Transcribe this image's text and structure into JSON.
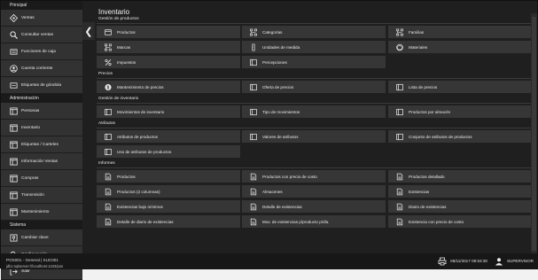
{
  "sidebar": {
    "sections": [
      {
        "title": "Principal",
        "items": [
          {
            "label": "Ventas",
            "icon": "compass-icon"
          },
          {
            "label": "Consultar ventas",
            "icon": "search-icon"
          },
          {
            "label": "Funciones de caja",
            "icon": "cash-register-icon"
          },
          {
            "label": "Cuenta corriente",
            "icon": "account-icon"
          },
          {
            "label": "Etiquetas de góndola",
            "icon": "tag-icon"
          }
        ]
      },
      {
        "title": "Administración",
        "items": [
          {
            "label": "Personas",
            "icon": "window-icon"
          },
          {
            "label": "Inventario",
            "icon": "window-icon"
          },
          {
            "label": "Etiquetas / Carteles",
            "icon": "window-icon"
          },
          {
            "label": "Información Ventas",
            "icon": "window-icon"
          },
          {
            "label": "Compras",
            "icon": "window-icon"
          },
          {
            "label": "Transmisión",
            "icon": "window-icon"
          },
          {
            "label": "Mantenimiento",
            "icon": "window-icon"
          }
        ]
      },
      {
        "title": "Sistema",
        "items": [
          {
            "label": "Cambiar clave",
            "icon": "password-icon"
          },
          {
            "label": "Configuración",
            "icon": "settings-icon"
          },
          {
            "label": "Salir",
            "icon": "exit-icon"
          }
        ]
      }
    ],
    "collapse_icon": "chevron-left-icon"
  },
  "main": {
    "title": "Inventario",
    "sections": [
      {
        "title": "Gestión de productos",
        "tiles": [
          {
            "label": "Productos",
            "icon": "product-icon"
          },
          {
            "label": "Categorías",
            "icon": "hierarchy-icon"
          },
          {
            "label": "Familias",
            "icon": "hierarchy-icon"
          },
          {
            "label": "Marcas",
            "icon": "hierarchy-icon"
          },
          {
            "label": "Unidades de medida",
            "icon": "ruler-icon"
          },
          {
            "label": "Materiales",
            "icon": "material-icon"
          },
          {
            "label": "Impuestos",
            "icon": "percent-icon"
          },
          {
            "label": "Percepciones",
            "icon": "panel-icon"
          }
        ]
      },
      {
        "title": "Precios",
        "tiles": [
          {
            "label": "Mantenimiento de precios",
            "icon": "dollar-icon"
          },
          {
            "label": "Oferta de precios",
            "icon": "panel-icon"
          },
          {
            "label": "Lista de precios",
            "icon": "panel-icon"
          }
        ]
      },
      {
        "title": "Gestión de inventario",
        "tiles": [
          {
            "label": "Movimientos de inventario",
            "icon": "panel-icon"
          },
          {
            "label": "Tipo de movimientos",
            "icon": "panel-icon"
          },
          {
            "label": "Productos por almacén",
            "icon": "panel-icon"
          }
        ]
      },
      {
        "title": "Atributos",
        "tiles": [
          {
            "label": "Atributos de productos",
            "icon": "panel-icon"
          },
          {
            "label": "Valores de atributos",
            "icon": "panel-icon"
          },
          {
            "label": "Conjunto de atributos de productos",
            "icon": "panel-icon"
          },
          {
            "label": "Uso de atributos de productos",
            "icon": "panel-icon"
          }
        ]
      },
      {
        "title": "Informes",
        "tiles": [
          {
            "label": "Productos",
            "icon": "document-icon"
          },
          {
            "label": "Productos con precio de costo",
            "icon": "document-icon"
          },
          {
            "label": "Productos detallado",
            "icon": "document-icon"
          },
          {
            "label": "Productos (2 columnas)",
            "icon": "document-icon"
          },
          {
            "label": "Almacenes",
            "icon": "document-icon"
          },
          {
            "label": "Existencias",
            "icon": "document-icon"
          },
          {
            "label": "Existencias bajo mínimos",
            "icon": "document-icon"
          },
          {
            "label": "Detalle de existencias",
            "icon": "document-icon"
          },
          {
            "label": "Diario de existencias",
            "icon": "document-icon"
          },
          {
            "label": "Detalle de diario de existencias",
            "icon": "document-icon"
          },
          {
            "label": "Mov. de existencias p/producto p/día",
            "icon": "document-icon"
          },
          {
            "label": "Existencia con precio de costo",
            "icon": "document-icon"
          }
        ]
      }
    ]
  },
  "status": {
    "session": "POS001 - General | SUC001",
    "connection": "jdbc:sqlserver://localhost:1433/pos",
    "datetime": "08/11/2017 09:53:30",
    "user": "SUPERVISOR",
    "printer_icon": "printer-icon",
    "user_icon": "user-icon"
  }
}
